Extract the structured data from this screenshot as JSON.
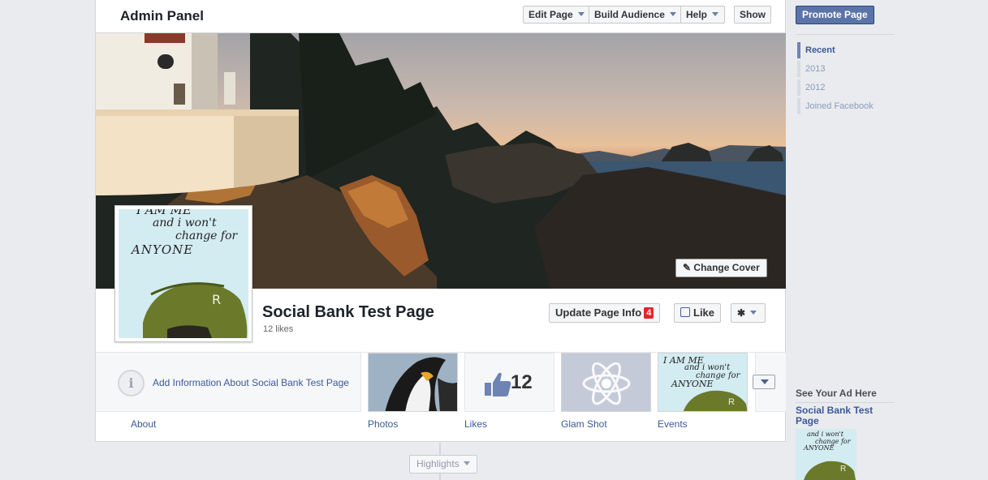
{
  "admin": {
    "title": "Admin Panel",
    "edit_page": "Edit Page",
    "build_audience": "Build Audience",
    "help": "Help",
    "show": "Show"
  },
  "cover": {
    "change_cover": "Change Cover",
    "pencil_icon": "pencil-icon"
  },
  "profile": {
    "pic_line1": "I AM ME",
    "pic_line2": "and i won't",
    "pic_line3": "change for",
    "pic_line4": "ANYONE",
    "cap_letter": "R"
  },
  "page": {
    "name": "Social Bank Test Page",
    "likes_text": "12 likes",
    "update_info": "Update Page Info",
    "update_badge": "4",
    "like": "Like",
    "gear_symbol": "✱"
  },
  "apps": {
    "about_prompt": "Add Information About Social Bank Test Page",
    "about_icon_glyph": "i",
    "labels": {
      "about": "About",
      "photos": "Photos",
      "likes": "Likes",
      "glam": "Glam Shot",
      "events": "Events"
    },
    "likes_count": "12",
    "events_line1": "I AM ME",
    "events_line2": "and i won't",
    "events_line3": "change for",
    "events_line4": "ANYONE",
    "events_cap": "R"
  },
  "timeline": {
    "highlights": "Highlights"
  },
  "sidebar": {
    "promote": "Promote Page",
    "years": [
      {
        "label": "Recent",
        "active": true
      },
      {
        "label": "2013",
        "active": false
      },
      {
        "label": "2012",
        "active": false
      },
      {
        "label": "Joined Facebook",
        "active": false
      }
    ],
    "see_ad": "See Your Ad Here",
    "ad_title": "Social Bank Test Page",
    "ad_line1": "and i won't",
    "ad_line2": "change for",
    "ad_line3": "ANYONE",
    "ad_cap": "R"
  },
  "colors": {
    "brand_blue": "#3b5998",
    "promote_blue": "#5b74a8",
    "badge_red": "#e0262b"
  }
}
